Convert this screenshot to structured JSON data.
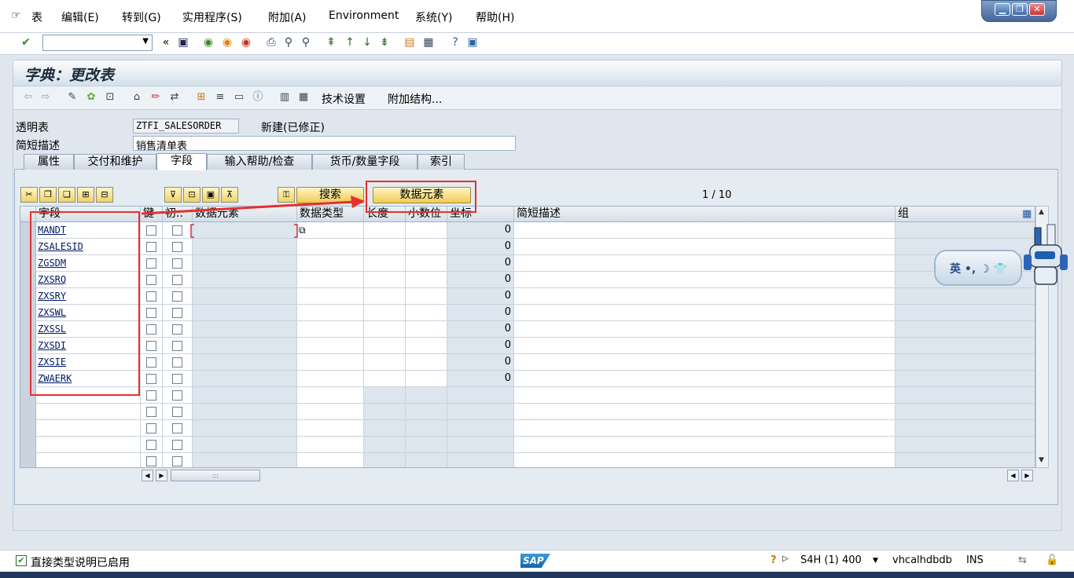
{
  "menu": {
    "items": [
      "表",
      "编辑(E)",
      "转到(G)",
      "实用程序(S)",
      "附加(A)",
      "Environment",
      "系统(Y)",
      "帮助(H)"
    ]
  },
  "window_controls": {
    "minimize": "▁",
    "restore": "❐",
    "close": "✕"
  },
  "std_toolbar": {
    "command_field_value": "",
    "icons": [
      "enter-icon",
      "back-double-icon",
      "save-icon",
      "back-icon",
      "exit-icon",
      "cancel-icon",
      "print-icon",
      "find-icon",
      "find-next-icon",
      "first-page-icon",
      "prev-page-icon",
      "next-page-icon",
      "last-page-icon",
      "new-session-icon",
      "shortcut-icon",
      "help-icon",
      "customize-icon"
    ]
  },
  "title": "字典：更改表",
  "app_toolbar": {
    "technical_settings": "技术设置",
    "append_structure": "附加结构..."
  },
  "header": {
    "table_type_label": "透明表",
    "table_name": "ZTFI_SALESORDER",
    "status": "新建(已修正)",
    "short_desc_label": "简短描述",
    "short_desc_value": "销售清单表"
  },
  "tabs": [
    "属性",
    "交付和维护",
    "字段",
    "输入帮助/检查",
    "货币/数量字段",
    "索引"
  ],
  "active_tab": "字段",
  "table_toolbar": {
    "search_button": "搜索",
    "data_element_button": "数据元素",
    "page_info": "1 / 10"
  },
  "grid": {
    "columns": [
      "字段",
      "键",
      "初..",
      "数据元素",
      "数据类型",
      "长度",
      "小数位",
      "坐标",
      "简短描述",
      "组"
    ],
    "rows": [
      {
        "field": "MANDT",
        "coord": "0"
      },
      {
        "field": "ZSALESID",
        "coord": "0"
      },
      {
        "field": "ZGSDM",
        "coord": "0"
      },
      {
        "field": "ZXSRQ",
        "coord": "0"
      },
      {
        "field": "ZXSRY",
        "coord": "0"
      },
      {
        "field": "ZXSWL",
        "coord": "0"
      },
      {
        "field": "ZXSSL",
        "coord": "0"
      },
      {
        "field": "ZXSDI",
        "coord": "0"
      },
      {
        "field": "ZXSIE",
        "coord": "0"
      },
      {
        "field": "ZWAERK",
        "coord": "0"
      },
      {
        "field": "",
        "coord": ""
      },
      {
        "field": "",
        "coord": ""
      },
      {
        "field": "",
        "coord": ""
      },
      {
        "field": "",
        "coord": ""
      },
      {
        "field": "",
        "coord": ""
      }
    ],
    "scroll_thumb": ":::"
  },
  "ime": {
    "label": "英 •, ☽ 👕"
  },
  "statusbar": {
    "message": "直接类型说明已启用",
    "sap_logo": "SAP",
    "system": "S4H (1) 400",
    "server": "vhcalhdbdb",
    "mode": "INS"
  },
  "colors": {
    "annotation_red": "#e53030",
    "sap_blue": "#1563a8"
  }
}
